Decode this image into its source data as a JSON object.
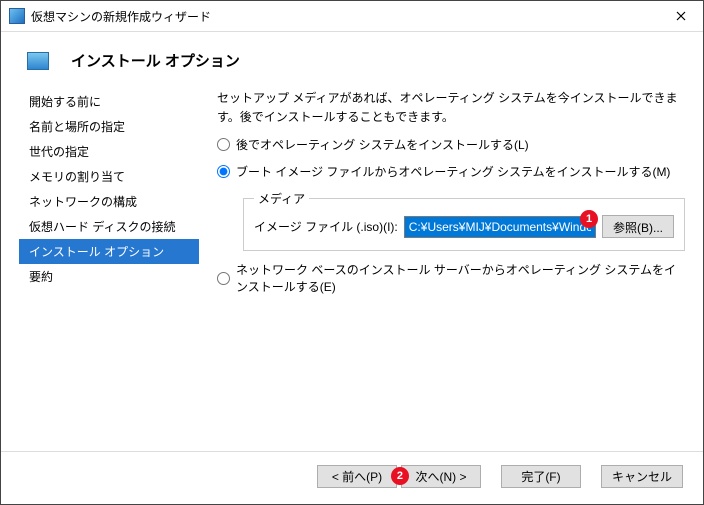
{
  "window": {
    "title": "仮想マシンの新規作成ウィザード"
  },
  "header": {
    "title": "インストール オプション"
  },
  "sidebar": {
    "items": [
      {
        "label": "開始する前に"
      },
      {
        "label": "名前と場所の指定"
      },
      {
        "label": "世代の指定"
      },
      {
        "label": "メモリの割り当て"
      },
      {
        "label": "ネットワークの構成"
      },
      {
        "label": "仮想ハード ディスクの接続"
      },
      {
        "label": "インストール オプション"
      },
      {
        "label": "要約"
      }
    ]
  },
  "content": {
    "description": "セットアップ メディアがあれば、オペレーティング システムを今インストールできます。後でインストールすることもできます。",
    "opt_later": "後でオペレーティング システムをインストールする(L)",
    "opt_boot_image": "ブート イメージ ファイルからオペレーティング システムをインストールする(M)",
    "media_legend": "メディア",
    "file_label": "イメージ ファイル (.iso)(I):",
    "file_value": "C:¥Users¥MIJ¥Documents¥Windows.iso",
    "browse_label": "参照(B)...",
    "opt_network": "ネットワーク ベースのインストール サーバーからオペレーティング システムをインストールする(E)"
  },
  "callouts": {
    "one": "1",
    "two": "2"
  },
  "footer": {
    "prev": "< 前へ(P)",
    "next": "次へ(N) >",
    "finish": "完了(F)",
    "cancel": "キャンセル"
  }
}
